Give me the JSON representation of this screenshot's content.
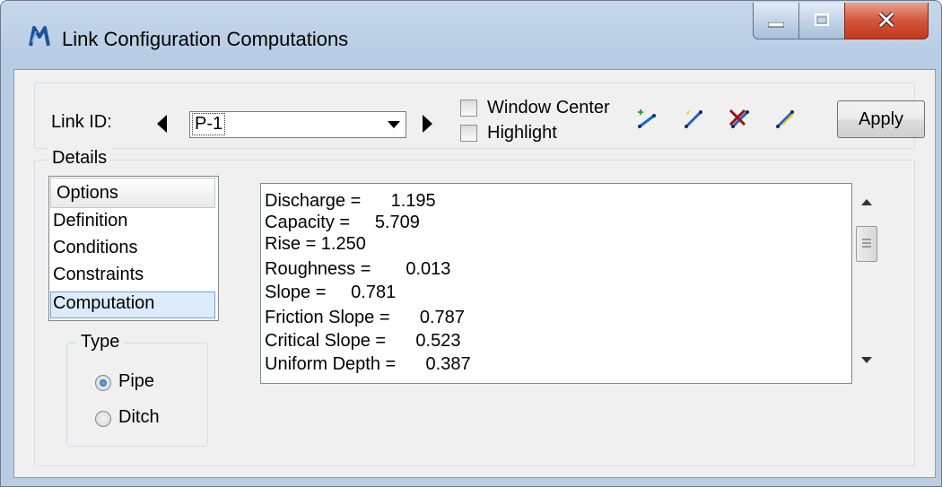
{
  "window": {
    "title": "Link Configuration Computations"
  },
  "toolbar": {
    "link_id_label": "Link ID:",
    "link_id_value": "P-1",
    "window_center_label": "Window Center",
    "highlight_label": "Highlight",
    "apply_label": "Apply",
    "icons": [
      "add-link-icon",
      "select-link-icon",
      "delete-link-icon",
      "edit-link-icon"
    ]
  },
  "details": {
    "legend": "Details",
    "options_header": "Options",
    "options": [
      "Definition",
      "Conditions",
      "Constraints",
      "Computation"
    ],
    "selected_option": "Computation",
    "type": {
      "legend": "Type",
      "choices": [
        "Pipe",
        "Ditch"
      ],
      "selected": "Pipe"
    },
    "results": [
      "Discharge =      1.195",
      "Capacity =     5.709",
      "Rise = 1.250",
      "Roughness =       0.013",
      "Slope =     0.781",
      "Friction Slope =      0.787",
      "Critical Slope =      0.523",
      "Uniform Depth =      0.387"
    ]
  },
  "colors": {
    "title_bar": "#b8cde4",
    "close_button": "#c94a2e",
    "selection": "#dcecfc"
  }
}
